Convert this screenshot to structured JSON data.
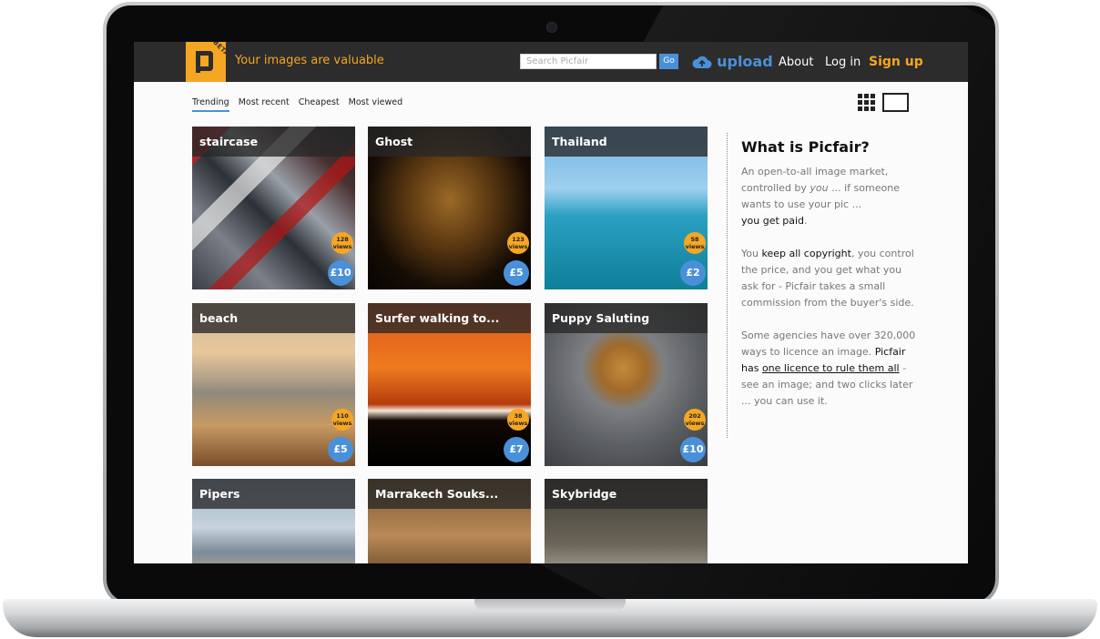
{
  "header": {
    "beta_badge": "BETA",
    "tagline": "Your images are valuable",
    "search_placeholder": "Search Picfair",
    "search_button": "Go",
    "upload_label": "upload",
    "nav": [
      "About",
      "Log in"
    ],
    "signup": "Sign up"
  },
  "tabs": [
    {
      "label": "Trending",
      "active": true
    },
    {
      "label": "Most recent",
      "active": false
    },
    {
      "label": "Cheapest",
      "active": false
    },
    {
      "label": "Most viewed",
      "active": false
    }
  ],
  "view_toggle": {
    "grid_icon": "grid-view-icon",
    "single_icon": "single-view-icon"
  },
  "tiles": [
    {
      "title": "staircase",
      "views": "128",
      "views_unit": "views",
      "price": "£10"
    },
    {
      "title": "Ghost",
      "views": "123",
      "views_unit": "views",
      "price": "£5"
    },
    {
      "title": "Thailand",
      "views": "58",
      "views_unit": "views",
      "price": "£2"
    },
    {
      "title": "beach",
      "views": "110",
      "views_unit": "views",
      "price": "£5"
    },
    {
      "title": "Surfer walking to...",
      "views": "38",
      "views_unit": "views",
      "price": "£7"
    },
    {
      "title": "Puppy Saluting",
      "views": "202",
      "views_unit": "views",
      "price": "£10"
    },
    {
      "title": "Pipers"
    },
    {
      "title": "Marrakech Souks..."
    },
    {
      "title": "Skybridge"
    }
  ],
  "sidebar": {
    "title": "What is Picfair?",
    "p1_a": "An open-to-all image market, controlled by ",
    "p1_you": "you",
    "p1_b": " ... if someone wants to use your pic ...",
    "p1_bold": "you get paid",
    "p1_end": ".",
    "p2_a": "You ",
    "p2_bold": "keep all copyright",
    "p2_b": ", you control the price, and you get what you ask for - Picfair takes a small commission from the buyer's side.",
    "p3_a": "Some agencies have over 320,000 ways to licence an image. ",
    "p3_bold": "Picfair has ",
    "p3_link": "one licence to rule them all",
    "p3_b": " - see an image; and two clicks later ... you can use it."
  },
  "colors": {
    "accent": "#f5a623",
    "blue": "#4a90d9",
    "topbar": "#2c2c2c"
  }
}
